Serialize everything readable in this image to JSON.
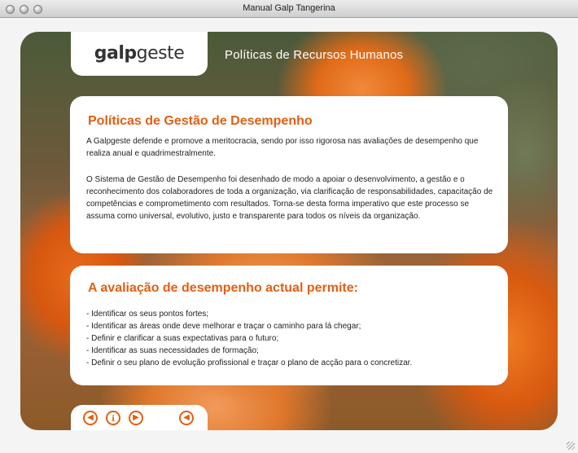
{
  "window": {
    "title": "Manual Galp Tangerina"
  },
  "header": {
    "logo_bold": "galp",
    "logo_light": "geste",
    "section_title": "Políticas de Recursos Humanos"
  },
  "card1": {
    "title": "Políticas de Gestão de Desempenho",
    "paragraph1": "A Galpgeste defende e promove a meritocracia, sendo por isso rigorosa nas avaliações de desempenho que realiza anual e quadrimestralmente.",
    "paragraph2": "O Sistema de Gestão de Desempenho foi desenhado de modo a apoiar o desenvolvimento, a gestão e o reconhecimento dos colaboradores de toda a organização, via clarificação de responsabilidades, capacitação de competências e comprometimento com resultados. Torna-se desta forma imperativo que este processo se assuma como universal, evolutivo, justo e transparente para todos os níveis da organização."
  },
  "card2": {
    "title": "A avaliação de desempenho actual permite:",
    "items": [
      "- Identificar os seus pontos fortes;",
      "- Identificar as áreas onde deve melhorar e traçar o caminho para lá chegar;",
      "- Definir e clarificar a suas expectativas para o futuro;",
      "- Identificar as suas necessidades de formação;",
      "- Definir o seu plano de evolução profissional e traçar o plano de acção para o concretizar."
    ]
  },
  "nav": {
    "prev_icon": "chevron-left-icon",
    "info_icon": "info-icon",
    "next_icon": "chevron-right-icon",
    "sound_icon": "back-triangle-icon",
    "prev_glyph": "◀",
    "info_glyph": "i",
    "next_glyph": "▶",
    "sound_glyph": "◀"
  },
  "colors": {
    "accent": "#e25f12"
  }
}
